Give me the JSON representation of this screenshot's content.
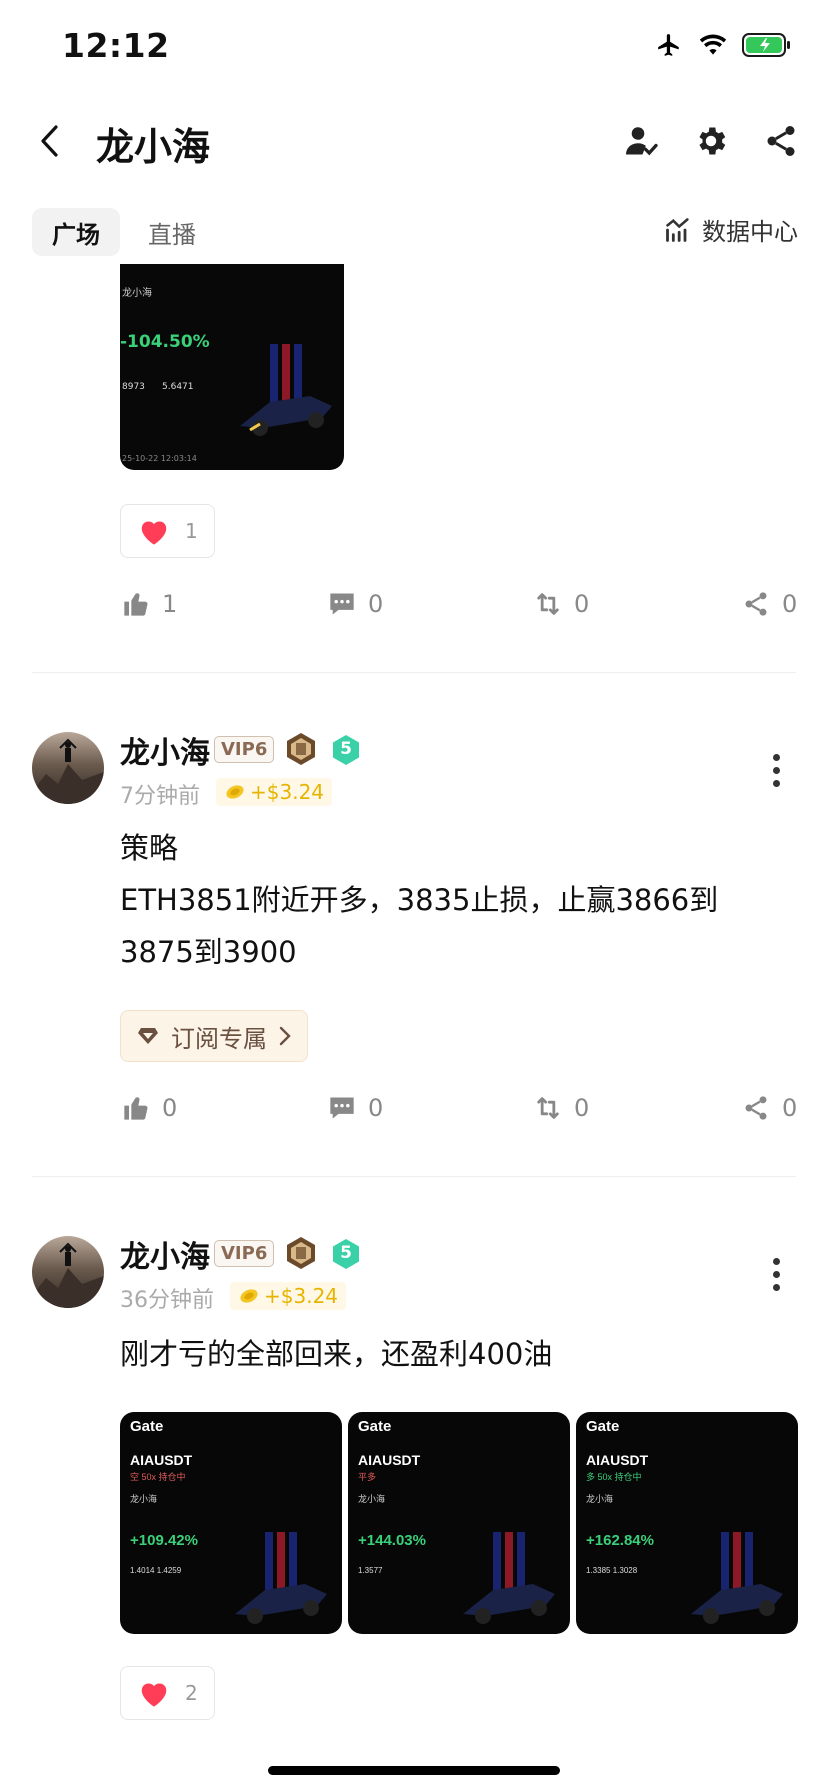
{
  "status_bar": {
    "time": "12:12"
  },
  "header": {
    "title": "龙小海"
  },
  "tabs": [
    {
      "label": "广场"
    },
    {
      "label": "直播"
    }
  ],
  "data_center": {
    "label": "数据中心"
  },
  "post1": {
    "image": {
      "name": "龙小海",
      "pnl": "-104.50%",
      "mark_price": "8973",
      "open_price": "5.6471",
      "timestamp": "25-10-22 12:03:14"
    },
    "reaction_count": "1",
    "likes": "1",
    "comments": "0",
    "reposts": "0",
    "shares": "0"
  },
  "post2": {
    "username": "龙小海",
    "vip": "VIP6",
    "level": "5",
    "time": "7分钟前",
    "reward": "+$3.24",
    "line1": "策略",
    "line2": "ETH3851附近开多，3835止损，止赢3866到",
    "line3": "3875到3900",
    "subscribe_label": "订阅专属",
    "likes": "0",
    "comments": "0",
    "reposts": "0",
    "shares": "0"
  },
  "post3": {
    "username": "龙小海",
    "vip": "VIP6",
    "level": "5",
    "time": "36分钟前",
    "reward": "+$3.24",
    "text": "刚才亏的全部回来，还盈利400油",
    "images": [
      {
        "brand": "Gate",
        "pair": "AIAUSDT",
        "leverage": "空 50x 持仓中",
        "user": "龙小海",
        "pnl": "+109.42%",
        "nums": "1.4014    1.4259"
      },
      {
        "brand": "Gate",
        "pair": "AIAUSDT",
        "leverage": "平多",
        "user": "龙小海",
        "pnl": "+144.03%",
        "nums": "1.3577"
      },
      {
        "brand": "Gate",
        "pair": "AIAUSDT",
        "leverage": "多 50x 持仓中",
        "user": "龙小海",
        "pnl": "+162.84%",
        "nums": "1.3385    1.3028"
      }
    ],
    "reaction_count": "2"
  },
  "colors": {
    "heart": "#ff3d57",
    "positive": "#3ad07a",
    "gold": "#e6b400",
    "level_badge": "#3bd1a8"
  }
}
